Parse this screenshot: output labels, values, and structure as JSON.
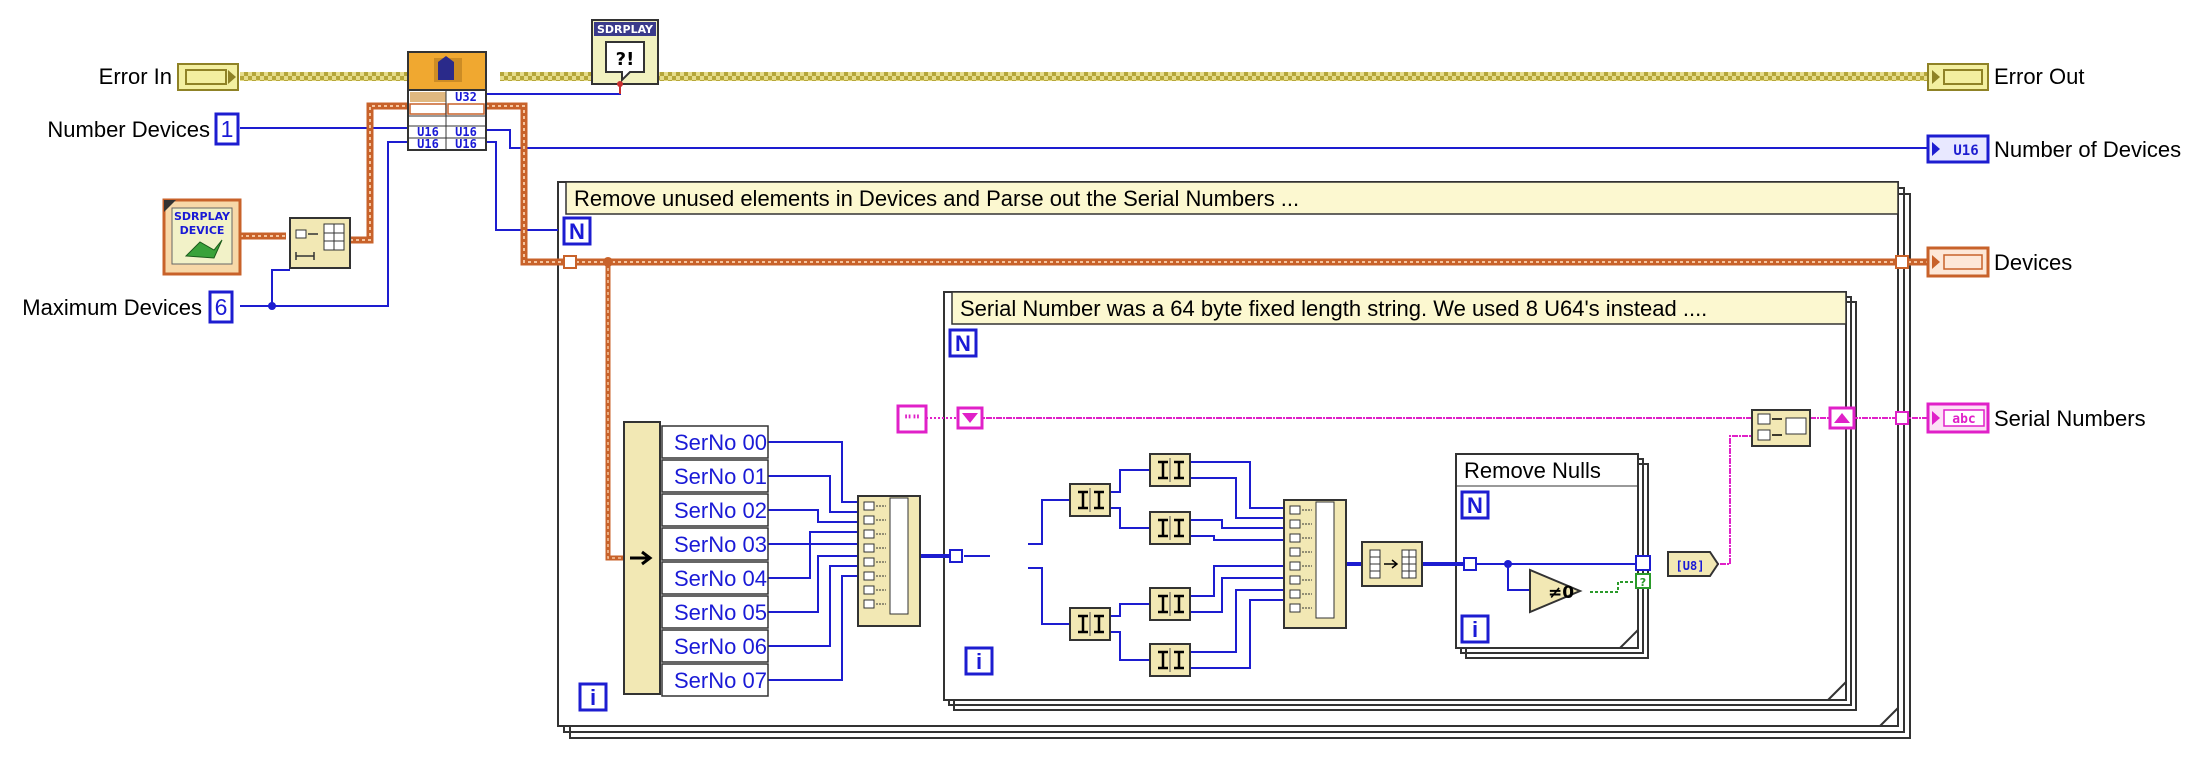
{
  "controls": {
    "error_in": "Error In",
    "number_devices": "Number Devices",
    "number_devices_value": "1",
    "maximum_devices": "Maximum Devices",
    "maximum_devices_value": "6"
  },
  "indicators": {
    "error_out": "Error Out",
    "number_of_devices": "Number of Devices",
    "number_of_devices_type": "U16",
    "devices": "Devices",
    "serial_numbers": "Serial Numbers",
    "serial_numbers_type": "abc"
  },
  "sdrplay_icon": {
    "brand": "SDRPLAY",
    "sub": "DEVICE"
  },
  "error_vi": {
    "brand": "SDRPLAY",
    "symbol": "?!"
  },
  "cluster_node": {
    "rows": [
      "U32",
      "U16",
      "U16"
    ]
  },
  "outer_loop": {
    "comment": "Remove unused elements in Devices and Parse out the Serial Numbers ...",
    "n_label": "N",
    "i_label": "i"
  },
  "unbundle_items": [
    "SerNo 00",
    "SerNo 01",
    "SerNo 02",
    "SerNo 03",
    "SerNo 04",
    "SerNo 05",
    "SerNo 06",
    "SerNo 07"
  ],
  "inner_loop": {
    "comment": "Serial Number was a 64 byte fixed length string.  We used 8 U64's instead ....",
    "n_label": "N",
    "i_label": "i"
  },
  "nulls_loop": {
    "title": "Remove Nulls",
    "n_label": "N",
    "i_label": "i",
    "compare": "≠0"
  },
  "nodes": {
    "u8_to_string": "[U8]",
    "empty_string": "\"\""
  },
  "colors": {
    "error_wire": "#a89a2a",
    "int_wire": "#1d1dd0",
    "cluster_wire": "#c8622a",
    "string_wire": "#e020c8",
    "bool_wire": "#2a9a2a",
    "node_fill": "#f2e8b4",
    "comment_fill": "#fcf8d0"
  }
}
